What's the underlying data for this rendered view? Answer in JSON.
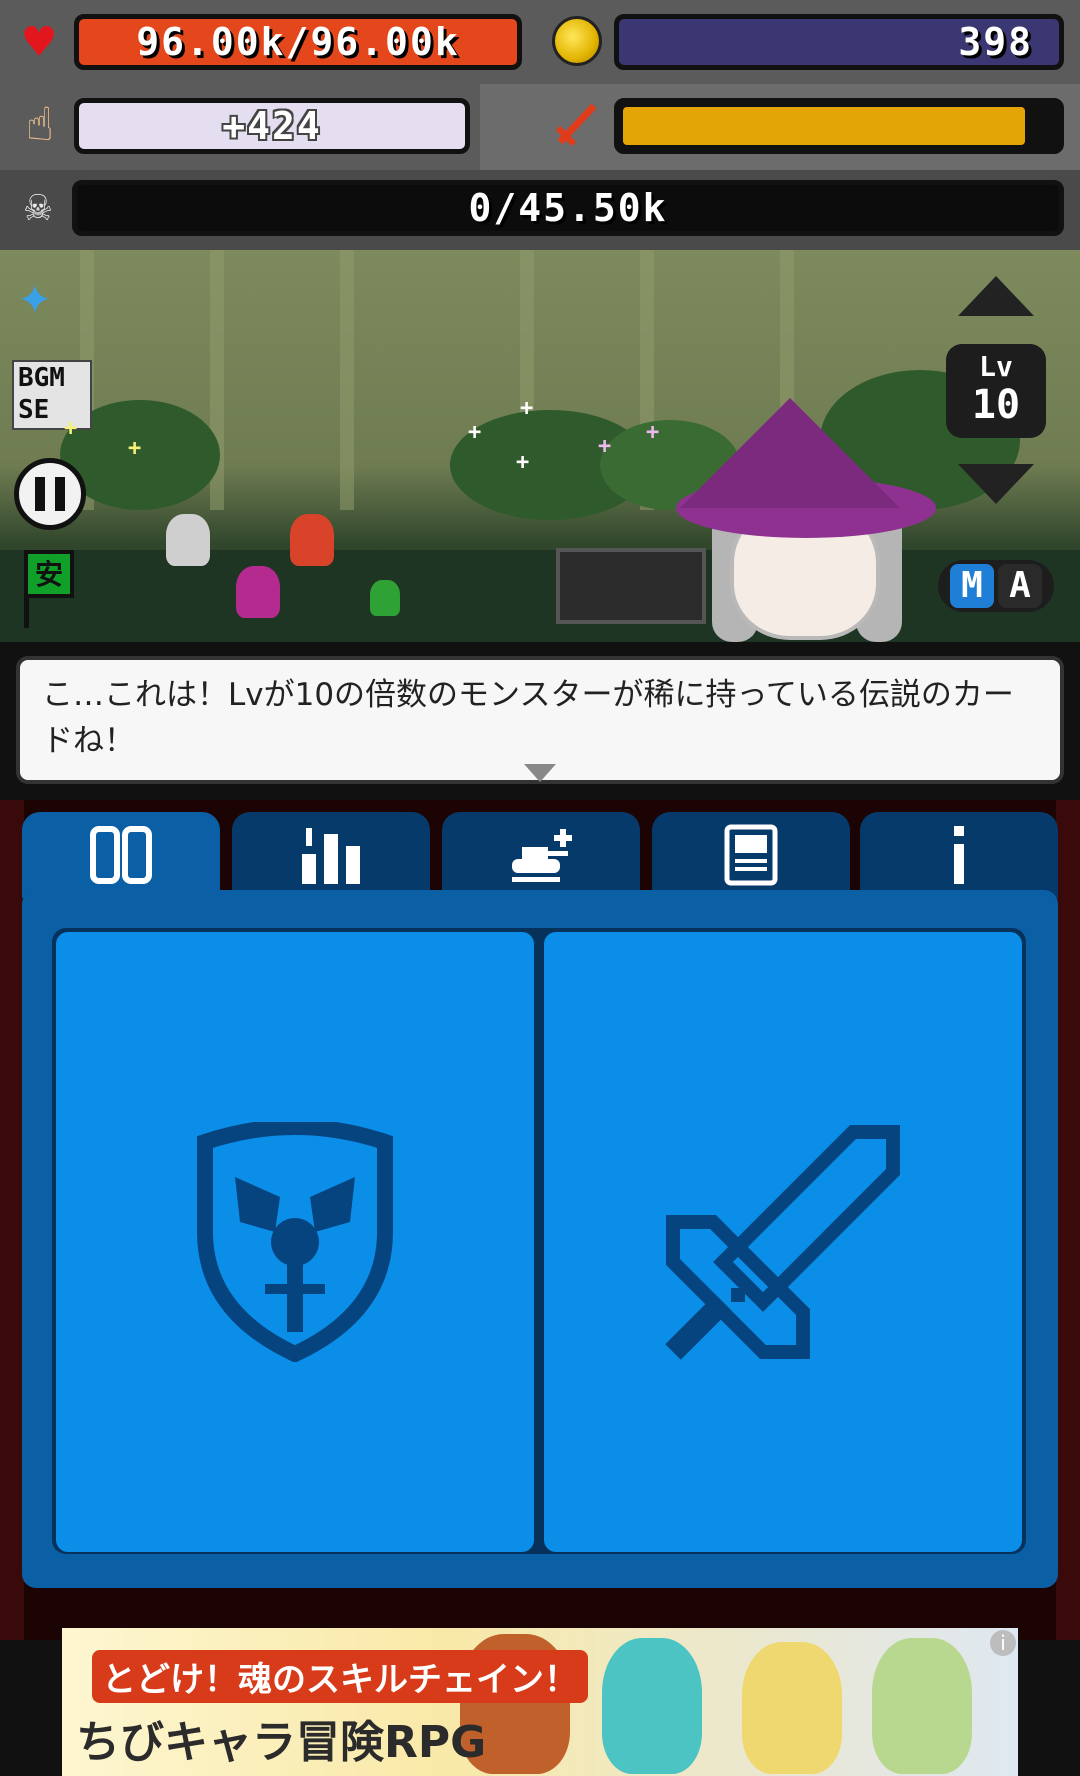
{
  "hud": {
    "hp": "96.00k/96.00k",
    "gold": "398",
    "tap_damage": "+424",
    "power_fill_fraction": 0.93,
    "kill_progress": "0/45.50k"
  },
  "scene": {
    "sound_toggle": "BGM\nSE",
    "safe_label": "安",
    "level_label": "Lv",
    "level_value": "10",
    "mode_m": "M",
    "mode_a": "A"
  },
  "dialog": {
    "text": "こ…これは！Lvが10の倍数のモンスターが稀に持っている伝説のカードね！"
  },
  "tabs": [
    {
      "name": "cards-tab",
      "icon": "card-icon",
      "active": true
    },
    {
      "name": "stats-tab",
      "icon": "stats-icon",
      "active": false
    },
    {
      "name": "summon-tab",
      "icon": "tank-add-icon",
      "active": false
    },
    {
      "name": "device-tab",
      "icon": "device-icon",
      "active": false
    },
    {
      "name": "info-tab",
      "icon": "info-icon",
      "active": false
    }
  ],
  "cards": [
    {
      "name": "shield-card",
      "icon": "shield-icon"
    },
    {
      "name": "sword-card",
      "icon": "sword-icon"
    }
  ],
  "ad": {
    "line1": "とどけ！魂のスキルチェイン！",
    "line2": "ちびキャラ冒険RPG",
    "info": "i"
  },
  "colors": {
    "hp_bar": "#e5471c",
    "gold_bar": "#3b3773",
    "power_fill": "#e3a405",
    "tab_active": "#0a5fa5",
    "card_bg": "#0a8ee8"
  }
}
